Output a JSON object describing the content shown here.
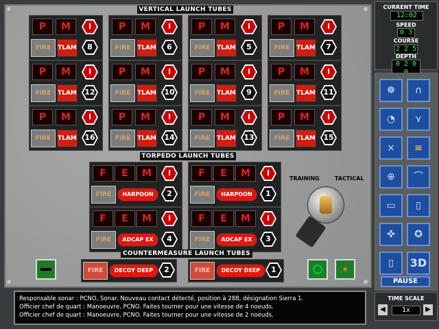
{
  "banners": {
    "vertical": "VERTICAL LAUNCH TUBES",
    "torpedo": "TORPEDO LAUNCH TUBES",
    "counter": "COUNTERMEASURE LAUNCH TUBES"
  },
  "vls": [
    {
      "n": "8",
      "p": "P",
      "m": "M",
      "i": "I",
      "fire": "FIRE",
      "w": "TLAM"
    },
    {
      "n": "6",
      "p": "P",
      "m": "M",
      "i": "I",
      "fire": "FIRE",
      "w": "TLAM"
    },
    {
      "n": "5",
      "p": "P",
      "m": "M",
      "i": "I",
      "fire": "FIRE",
      "w": "TLAM"
    },
    {
      "n": "7",
      "p": "P",
      "m": "M",
      "i": "I",
      "fire": "FIRE",
      "w": "TLAM"
    },
    {
      "n": "12",
      "p": "P",
      "m": "M",
      "i": "I",
      "fire": "FIRE",
      "w": "TLAM"
    },
    {
      "n": "10",
      "p": "P",
      "m": "M",
      "i": "I",
      "fire": "FIRE",
      "w": "TLAM"
    },
    {
      "n": "9",
      "p": "P",
      "m": "M",
      "i": "I",
      "fire": "FIRE",
      "w": "TLAM"
    },
    {
      "n": "11",
      "p": "P",
      "m": "M",
      "i": "I",
      "fire": "FIRE",
      "w": "TLAM"
    },
    {
      "n": "16",
      "p": "P",
      "m": "M",
      "i": "I",
      "fire": "FIRE",
      "w": "TLAM"
    },
    {
      "n": "14",
      "p": "P",
      "m": "M",
      "i": "I",
      "fire": "FIRE",
      "w": "TLAM"
    },
    {
      "n": "13",
      "p": "P",
      "m": "M",
      "i": "I",
      "fire": "FIRE",
      "w": "TLAM"
    },
    {
      "n": "15",
      "p": "P",
      "m": "M",
      "i": "I",
      "fire": "FIRE",
      "w": "TLAM"
    }
  ],
  "torpedo": [
    {
      "n": "2",
      "f": "F",
      "e": "E",
      "m": "M",
      "i": "I",
      "fire": "FIRE",
      "w": "HARPOON"
    },
    {
      "n": "1",
      "f": "F",
      "e": "E",
      "m": "M",
      "i": "I",
      "fire": "FIRE",
      "w": "HARPOON"
    },
    {
      "n": "4",
      "f": "F",
      "e": "E",
      "m": "M",
      "i": "I",
      "fire": "FIRE",
      "w": "ADCAP EX"
    },
    {
      "n": "3",
      "f": "F",
      "e": "E",
      "m": "M",
      "i": "I",
      "fire": "FIRE",
      "w": "ADCAP EX"
    }
  ],
  "counter": [
    {
      "n": "2",
      "fire": "FIRE",
      "w": "DECOY DEEP"
    },
    {
      "n": "1",
      "fire": "FIRE",
      "w": "DECOY DEEP"
    }
  ],
  "knob": {
    "training": "TRAINING",
    "tactical": "TACTICAL"
  },
  "status": {
    "time_label": "CURRENT TIME",
    "time": "12:02",
    "speed_label": "SPEED",
    "speed": "0 3",
    "course_label": "COURSE",
    "course": "2 2 5",
    "depth_label": "DEPTH",
    "depth": "0 2 0 0"
  },
  "pause": "PAUSE",
  "timescale": {
    "label": "TIME SCALE",
    "value": "1x"
  },
  "messages": [
    "Responsable sonar : PCNO, Sonar. Nouveau contact détecté, position à 288, désignation Sierra 1.",
    "Officier chef de quart : Manoeuvre, PCNO. Faites tourner pour une vitesse de 4 noeuds.",
    "Officier chef de quart : Manoeuvre, PCNO. Faites tourner pour une vitesse de 2 noeuds."
  ],
  "icons": [
    "helm-icon",
    "headphones-icon",
    "gauge-icon",
    "sonar-waterfall-icon",
    "periscope-icon",
    "list-icon",
    "crosshair-icon",
    "arc-icon",
    "book-icon",
    "chart-book-icon",
    "compass-icon",
    "star-icon",
    "door-icon",
    "3d-view-icon"
  ],
  "icon_labels": {
    "3d": "3D"
  }
}
